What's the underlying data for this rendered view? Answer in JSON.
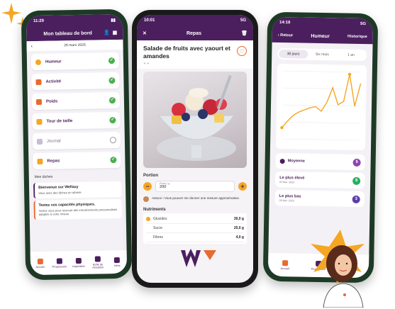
{
  "colors": {
    "brand_purple": "#4b1f5e",
    "accent_orange": "#e86a2e",
    "accent_yellow": "#f5a623",
    "check_green": "#4caf50"
  },
  "phone1": {
    "time": "11:29",
    "title": "Mon tableau de bord",
    "date": "29 mars 2025",
    "items": [
      {
        "label": "Humeur",
        "icon": "smiley-icon",
        "done": true
      },
      {
        "label": "Activité",
        "icon": "runner-icon",
        "done": true
      },
      {
        "label": "Poids",
        "icon": "scale-icon",
        "done": true
      },
      {
        "label": "Tour de taille",
        "icon": "tape-icon",
        "done": true
      },
      {
        "label": "Journal",
        "icon": "notebook-icon",
        "done": false
      },
      {
        "label": "Repas",
        "icon": "cutlery-icon",
        "done": true
      }
    ],
    "tasks_title": "Mes tâches",
    "tasks": [
      {
        "title": "Bienvenue sur Wellaxy",
        "subtitle": "Vous avez des tâches en attente"
      },
      {
        "title": "Testez vos capacités physiques.",
        "subtitle": "Testez vous pour recevoir des entraînements personnalisés adaptés à votre niveau"
      }
    ],
    "tabs": [
      "Accueil",
      "Progression",
      "Inspiration",
      "Boîte de réception",
      "Infos"
    ]
  },
  "phone2": {
    "time": "10:01",
    "signal": "5G",
    "title": "Repas",
    "recipe_title": "Salade de fruits avec yaourt et amandes",
    "portion_label": "Portion",
    "portion_placeholder": "Poids ( g",
    "portion_value": "200",
    "tip": "Astuce ! Vous pouvez me donner une mesure approximative.",
    "nutrition_title": "Nutriments",
    "nutrients": [
      {
        "label": "Glucides",
        "value": "30,0 g"
      },
      {
        "label": "Sucre",
        "value": "20,0 g"
      },
      {
        "label": "Fibres",
        "value": "4,0 g"
      }
    ]
  },
  "phone3": {
    "time": "14:18",
    "signal": "5G",
    "back_label": "Retour",
    "title": "Humeur",
    "history_label": "Historique",
    "ranges": [
      "30 jours",
      "Six mois",
      "1 an"
    ],
    "selected_range": "30 jours",
    "chart_data": {
      "type": "line",
      "series": [
        {
          "values": [
            2,
            2.6,
            3.1,
            3.4,
            3.6,
            3.8,
            3.9,
            3.5,
            4.3,
            5.6,
            4.1,
            4.4,
            6.8,
            4.0,
            6.0
          ]
        }
      ]
    },
    "stats": [
      {
        "label": "Moyenne",
        "date": "",
        "value": "5",
        "color": "#8e44ad"
      },
      {
        "label": "Le plus élevé",
        "date": "03 Mar. 2025",
        "value": "8",
        "color": "#27ae60"
      },
      {
        "label": "Le plus bas",
        "date": "26 Mar. 2025",
        "value": "3",
        "color": "#5b3fa8"
      }
    ],
    "tabs": [
      "Accueil",
      "Progression",
      "Inspiration"
    ]
  }
}
